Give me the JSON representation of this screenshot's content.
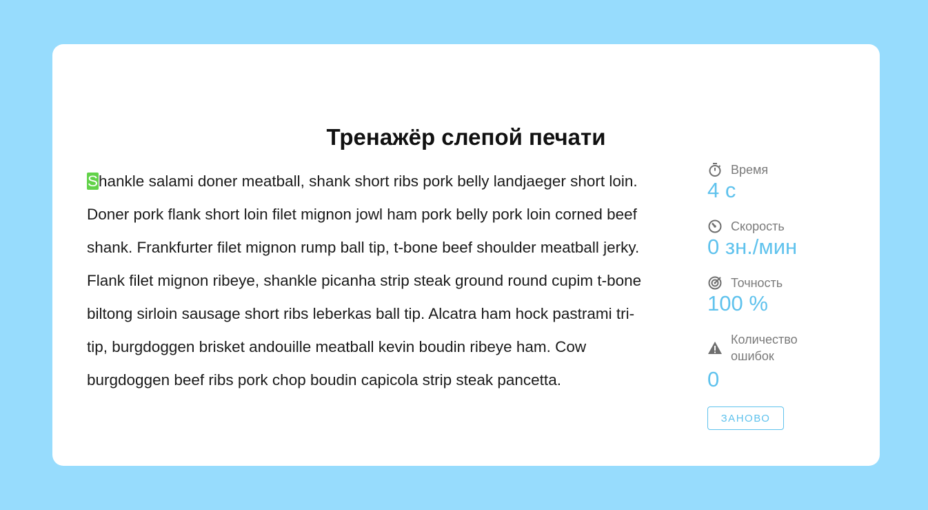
{
  "title": "Тренажёр слепой печати",
  "text": {
    "current_char": "S",
    "remaining": "hankle salami doner meatball, shank short ribs pork belly landjaeger short loin. Doner pork flank short loin filet mignon jowl ham pork belly pork loin corned beef shank. Frankfurter filet mignon rump ball tip, t-bone beef shoulder meatball jerky. Flank filet mignon ribeye, shankle picanha strip steak ground round cupim t-bone biltong sirloin sausage short ribs leberkas ball tip. Alcatra ham hock pastrami tri-tip, burgdoggen brisket andouille meatball kevin boudin ribeye ham. Cow burgdoggen beef ribs pork chop boudin capicola strip steak pancetta."
  },
  "stats": {
    "time": {
      "icon": "stopwatch-icon",
      "label": "Время",
      "value": "4 с"
    },
    "speed": {
      "icon": "speedometer-icon",
      "label": "Скорость",
      "value": "0 зн./мин"
    },
    "accuracy": {
      "icon": "target-icon",
      "label": "Точность",
      "value": "100 %"
    },
    "errors": {
      "icon": "warning-icon",
      "label": "Количество ошибок",
      "value": "0"
    }
  },
  "restart_label": "Заново",
  "colors": {
    "background": "#97dcfd",
    "accent": "#5fc2ed",
    "cursor": "#62d249"
  }
}
